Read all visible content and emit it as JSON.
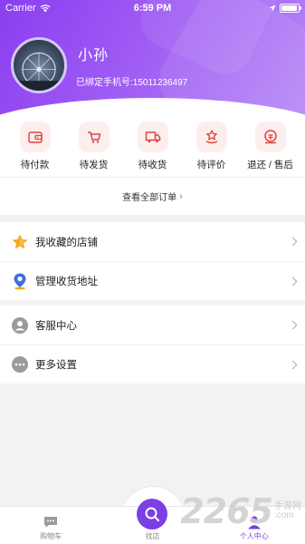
{
  "status_bar": {
    "carrier": "Carrier",
    "time": "6:59 PM"
  },
  "profile": {
    "name": "小孙",
    "phone_text": "已绑定手机号:15011236497"
  },
  "orders": [
    {
      "label": "待付款",
      "icon": "wallet-icon"
    },
    {
      "label": "待发货",
      "icon": "cart-icon"
    },
    {
      "label": "待收货",
      "icon": "truck-icon"
    },
    {
      "label": "待评价",
      "icon": "star-hand-icon"
    },
    {
      "label": "退还 / 售后",
      "icon": "refund-icon"
    }
  ],
  "all_orders_label": "查看全部订单",
  "menu_group1": [
    {
      "label": "我收藏的店铺",
      "icon": "star-icon"
    },
    {
      "label": "管理收货地址",
      "icon": "location-icon"
    }
  ],
  "menu_group2": [
    {
      "label": "客服中心",
      "icon": "person-icon"
    },
    {
      "label": "更多设置",
      "icon": "more-icon"
    }
  ],
  "tabbar": [
    {
      "label": "购物车",
      "icon": "chat-cart-icon"
    },
    {
      "label": "找店",
      "icon": "shop-search-icon"
    },
    {
      "label": "个人中心",
      "icon": "user-icon"
    }
  ],
  "watermark": {
    "number": "2265",
    "line1": "手游网",
    "line2": ".com"
  },
  "colors": {
    "accent": "#7b3fe4",
    "order_icon": "#e0443e",
    "star": "#f5a623",
    "location": "#3c6ee0"
  }
}
